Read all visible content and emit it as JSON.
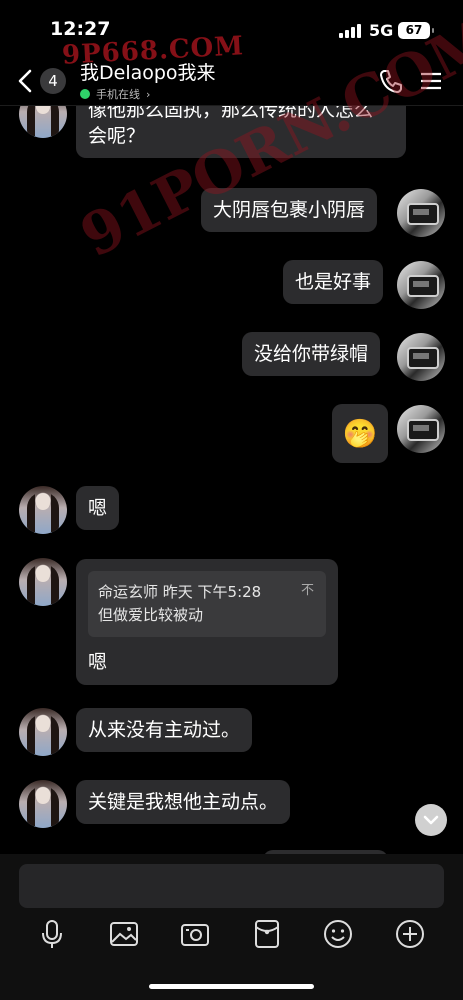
{
  "status": {
    "time": "12:27",
    "network": "5G",
    "battery": "67"
  },
  "watermarks": {
    "top": "9P668.COM",
    "diagonal": "91PORN.COM"
  },
  "header": {
    "unread_count": "4",
    "contact_name": "我Delaopo我来",
    "presence": "手机在线"
  },
  "messages": [
    {
      "side": "left",
      "avatar": "girl",
      "text_lines": [
        "像他那么固执，那么传统的人怎么",
        "会呢？"
      ]
    },
    {
      "side": "right",
      "avatar": "car",
      "text": "大阴唇包裹小阴唇"
    },
    {
      "side": "right",
      "avatar": "car",
      "text": "也是好事"
    },
    {
      "side": "right",
      "avatar": "car",
      "text": "没给你带绿帽"
    },
    {
      "side": "right",
      "avatar": "car",
      "emoji": "🤭"
    },
    {
      "side": "left",
      "avatar": "girl",
      "text": "嗯"
    },
    {
      "side": "left",
      "avatar": "girl",
      "quote": {
        "header": "命运玄师 昨天 下午5:28",
        "text": "但做爱比较被动",
        "close": "不"
      },
      "text": "嗯"
    },
    {
      "side": "left",
      "avatar": "girl",
      "text": "从来没有主动过。"
    },
    {
      "side": "left",
      "avatar": "girl",
      "text": "关键是我想他主动点。"
    }
  ],
  "input": {
    "placeholder": ""
  },
  "toolbar": [
    "microphone-icon",
    "image-icon",
    "camera-icon",
    "red-packet-icon",
    "emoji-icon",
    "plus-icon"
  ],
  "colors": {
    "bubble": "#2c2c2e",
    "online": "#2fd36a",
    "background": "#000000"
  }
}
